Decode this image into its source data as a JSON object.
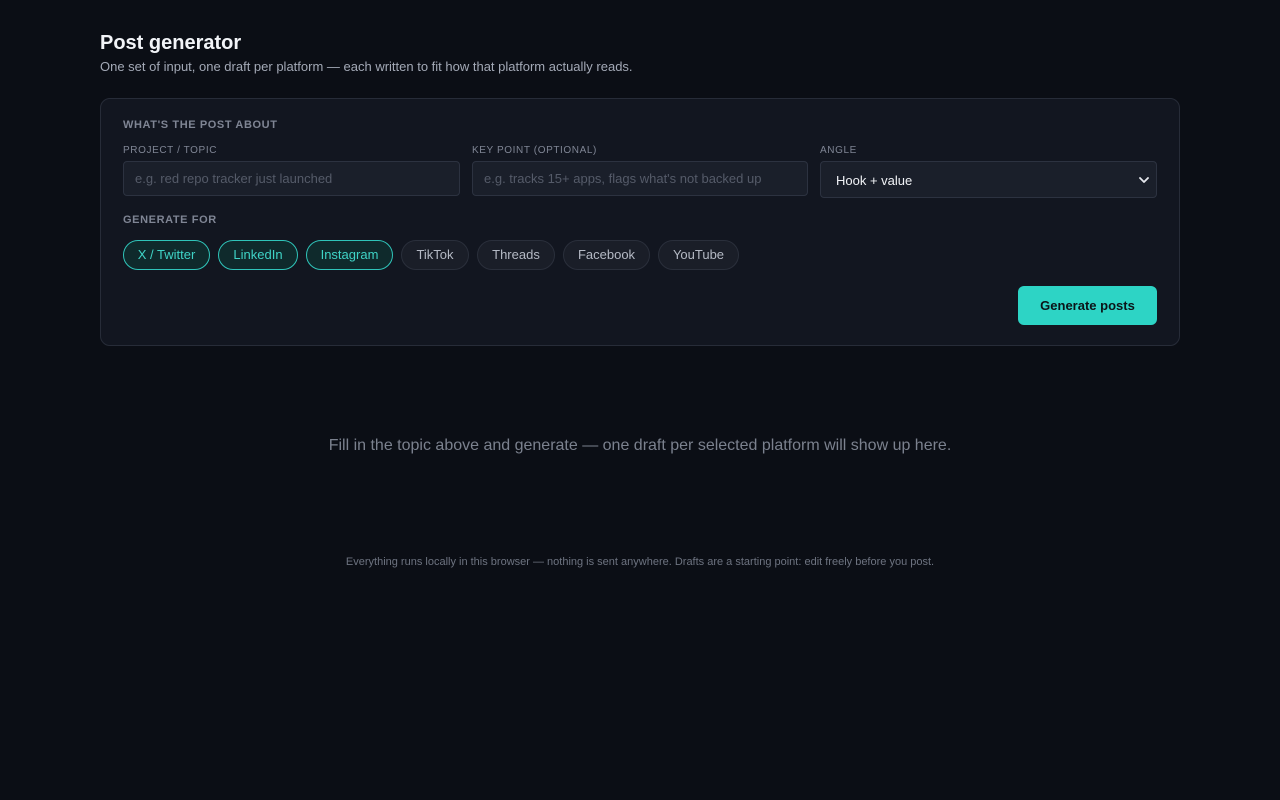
{
  "header": {
    "title": "Post generator",
    "subtitle": "One set of input, one draft per platform — each written to fit how that platform actually reads."
  },
  "form": {
    "section_label": "What's the post about",
    "topic": {
      "label": "Project / topic",
      "value": "",
      "placeholder": "e.g. red repo tracker just launched"
    },
    "key_point": {
      "label": "Key point (optional)",
      "value": "",
      "placeholder": "e.g. tracks 15+ apps, flags what's not backed up"
    },
    "angle": {
      "label": "Angle",
      "selected": "Hook + value"
    },
    "platforms_label": "Generate for",
    "platforms": [
      {
        "label": "X / Twitter",
        "selected": true
      },
      {
        "label": "LinkedIn",
        "selected": true
      },
      {
        "label": "Instagram",
        "selected": true
      },
      {
        "label": "TikTok",
        "selected": false
      },
      {
        "label": "Threads",
        "selected": false
      },
      {
        "label": "Facebook",
        "selected": false
      },
      {
        "label": "YouTube",
        "selected": false
      }
    ],
    "generate_label": "Generate posts"
  },
  "empty_state": "Fill in the topic above and generate — one draft per selected platform will show up here.",
  "footer": "Everything runs locally in this browser — nothing is sent anywhere. Drafts are a starting point: edit freely before you post.",
  "colors": {
    "background": "#0b0e15",
    "card": "#121620",
    "accent": "#2dd4c5"
  }
}
